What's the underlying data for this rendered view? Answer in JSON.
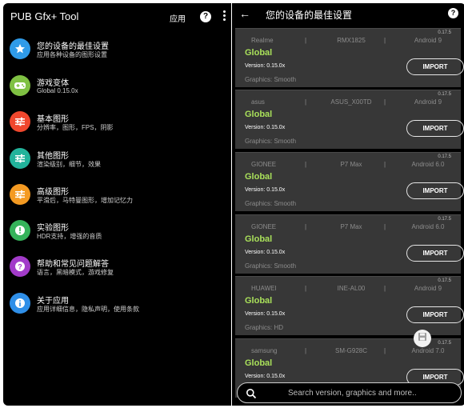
{
  "left": {
    "app_title": "PUB Gfx+ Tool",
    "apply_label": "应用",
    "help_glyph": "?",
    "menu": [
      {
        "title": "您的设备的最佳设置",
        "subtitle": "应用各种设备的图形设置",
        "icon": "star-icon",
        "color": "#2f9be8"
      },
      {
        "title": "游戏变体",
        "subtitle": "Global 0.15.0x",
        "icon": "gamepad-icon",
        "color": "#7fc143"
      },
      {
        "title": "基本图形",
        "subtitle": "分辨率，图形，FPS，阴影",
        "icon": "sliders-icon",
        "color": "#f0472d"
      },
      {
        "title": "其他图形",
        "subtitle": "渲染级别，细节，效果",
        "icon": "sliders-icon",
        "color": "#22b39b"
      },
      {
        "title": "高级图形",
        "subtitle": "平滑后，马特曼图形，增加记忆力",
        "icon": "sliders-icon",
        "color": "#f49a22"
      },
      {
        "title": "实验图形",
        "subtitle": "HDR支持，增强的音质",
        "icon": "alert-icon",
        "color": "#35b35a"
      },
      {
        "title": "帮助和常见问题解答",
        "subtitle": "语言，黑暗模式，游戏修复",
        "icon": "help-icon",
        "color": "#a23bc9"
      },
      {
        "title": "关于应用",
        "subtitle": "应用详细信息，隐私声明，使用条款",
        "icon": "info-icon",
        "color": "#2f8fe8"
      }
    ]
  },
  "right": {
    "title": "您的设备的最佳设置",
    "back_glyph": "←",
    "help_glyph": "?",
    "cards": [
      {
        "ver": "0.17.5",
        "brand": "Realme",
        "model": "RMX1825",
        "android": "Android 9",
        "gfx": "Global",
        "version": "Version: 0.15.0x",
        "graphics": "Graphics: Smooth",
        "button": "IMPORT"
      },
      {
        "ver": "0.17.5",
        "brand": "asus",
        "model": "ASUS_X00TD",
        "android": "Android 9",
        "gfx": "Global",
        "version": "Version: 0.15.0x",
        "graphics": "Graphics: Smooth",
        "button": "IMPORT"
      },
      {
        "ver": "0.17.5",
        "brand": "GIONEE",
        "model": "P7 Max",
        "android": "Android 6.0",
        "gfx": "Global",
        "version": "Version: 0.15.0x",
        "graphics": "Graphics: Smooth",
        "button": "IMPORT"
      },
      {
        "ver": "0.17.5",
        "brand": "GIONEE",
        "model": "P7 Max",
        "android": "Android 6.0",
        "gfx": "Global",
        "version": "Version: 0.15.0x",
        "graphics": "Graphics: Smooth",
        "button": "IMPORT"
      },
      {
        "ver": "0.17.5",
        "brand": "HUAWEI",
        "model": "INE-AL00",
        "android": "Android 9",
        "gfx": "Global",
        "version": "Version: 0.15.0x",
        "graphics": "Graphics: HD",
        "button": "IMPORT"
      },
      {
        "ver": "0.17.5",
        "brand": "samsung",
        "model": "SM-G928C",
        "android": "Android 7.0",
        "gfx": "Global",
        "version": "Version: 0.15.0x",
        "graphics": "",
        "button": "IMPORT"
      }
    ],
    "search_placeholder": "Search version, graphics and more.."
  },
  "colors": {
    "background": "#000000",
    "card": "#373737",
    "gfx_accent": "#a9e05a"
  }
}
